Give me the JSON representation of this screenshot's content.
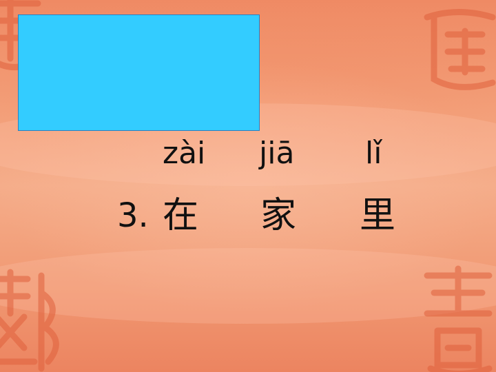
{
  "slide": {
    "pinyin": [
      "zài",
      "jiā",
      "lǐ"
    ],
    "number": "3.",
    "hanzi": [
      "在",
      "家",
      "里"
    ]
  },
  "colors": {
    "background": "#f19a74",
    "box": "#33ccff",
    "text": "#111111"
  },
  "icons": [
    "seal-stamp-icon"
  ]
}
